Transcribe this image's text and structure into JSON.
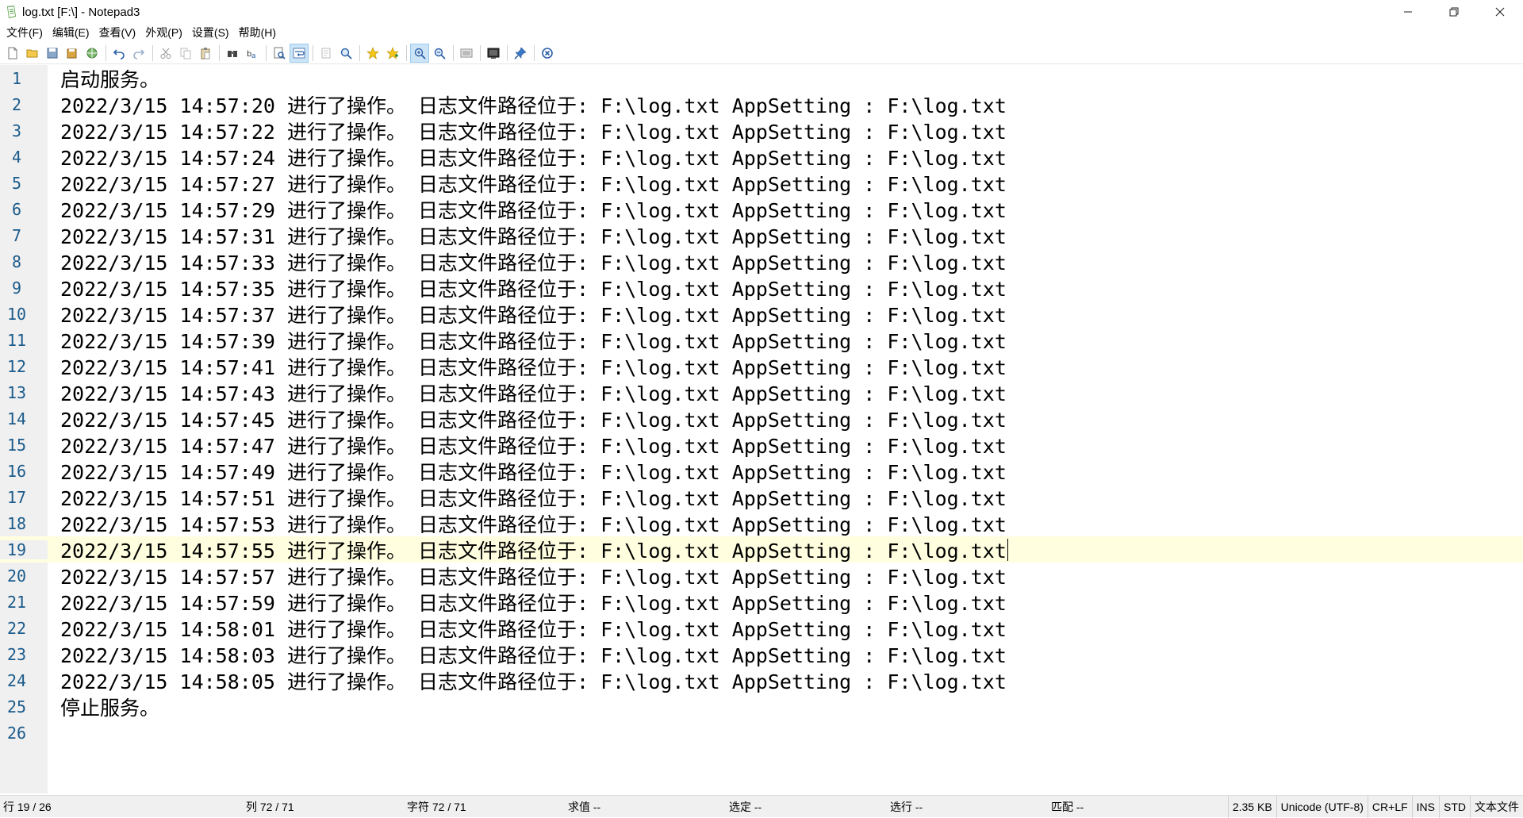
{
  "window": {
    "title": "log.txt [F:\\] - Notepad3",
    "controls": {
      "minimize": "—",
      "restore": "❐",
      "close": "✕"
    }
  },
  "menu": {
    "items": [
      "文件(F)",
      "编辑(E)",
      "查看(V)",
      "外观(P)",
      "设置(S)",
      "帮助(H)"
    ]
  },
  "toolbar": {
    "buttons": [
      "new-file-icon",
      "open-folder-icon",
      "save-icon",
      "save-as-icon",
      "browse-icon",
      "undo-icon",
      "redo-icon",
      "cut-icon",
      "copy-icon",
      "paste-icon",
      "find-icon",
      "replace-icon",
      "goto-icon",
      "word-wrap-icon",
      "zoom-in-icon",
      "zoom-out-icon",
      "favorites-icon",
      "add-favorite-icon",
      "search-icon",
      "filter-icon",
      "scheme-icon",
      "view-icon",
      "pin-icon",
      "exit-icon"
    ]
  },
  "editor": {
    "current_line": 19,
    "lines": [
      "启动服务。",
      "2022/3/15 14:57:20 进行了操作。 日志文件路径位于: F:\\log.txt AppSetting : F:\\log.txt",
      "2022/3/15 14:57:22 进行了操作。 日志文件路径位于: F:\\log.txt AppSetting : F:\\log.txt",
      "2022/3/15 14:57:24 进行了操作。 日志文件路径位于: F:\\log.txt AppSetting : F:\\log.txt",
      "2022/3/15 14:57:27 进行了操作。 日志文件路径位于: F:\\log.txt AppSetting : F:\\log.txt",
      "2022/3/15 14:57:29 进行了操作。 日志文件路径位于: F:\\log.txt AppSetting : F:\\log.txt",
      "2022/3/15 14:57:31 进行了操作。 日志文件路径位于: F:\\log.txt AppSetting : F:\\log.txt",
      "2022/3/15 14:57:33 进行了操作。 日志文件路径位于: F:\\log.txt AppSetting : F:\\log.txt",
      "2022/3/15 14:57:35 进行了操作。 日志文件路径位于: F:\\log.txt AppSetting : F:\\log.txt",
      "2022/3/15 14:57:37 进行了操作。 日志文件路径位于: F:\\log.txt AppSetting : F:\\log.txt",
      "2022/3/15 14:57:39 进行了操作。 日志文件路径位于: F:\\log.txt AppSetting : F:\\log.txt",
      "2022/3/15 14:57:41 进行了操作。 日志文件路径位于: F:\\log.txt AppSetting : F:\\log.txt",
      "2022/3/15 14:57:43 进行了操作。 日志文件路径位于: F:\\log.txt AppSetting : F:\\log.txt",
      "2022/3/15 14:57:45 进行了操作。 日志文件路径位于: F:\\log.txt AppSetting : F:\\log.txt",
      "2022/3/15 14:57:47 进行了操作。 日志文件路径位于: F:\\log.txt AppSetting : F:\\log.txt",
      "2022/3/15 14:57:49 进行了操作。 日志文件路径位于: F:\\log.txt AppSetting : F:\\log.txt",
      "2022/3/15 14:57:51 进行了操作。 日志文件路径位于: F:\\log.txt AppSetting : F:\\log.txt",
      "2022/3/15 14:57:53 进行了操作。 日志文件路径位于: F:\\log.txt AppSetting : F:\\log.txt",
      "2022/3/15 14:57:55 进行了操作。 日志文件路径位于: F:\\log.txt AppSetting : F:\\log.txt",
      "2022/3/15 14:57:57 进行了操作。 日志文件路径位于: F:\\log.txt AppSetting : F:\\log.txt",
      "2022/3/15 14:57:59 进行了操作。 日志文件路径位于: F:\\log.txt AppSetting : F:\\log.txt",
      "2022/3/15 14:58:01 进行了操作。 日志文件路径位于: F:\\log.txt AppSetting : F:\\log.txt",
      "2022/3/15 14:58:03 进行了操作。 日志文件路径位于: F:\\log.txt AppSetting : F:\\log.txt",
      "2022/3/15 14:58:05 进行了操作。 日志文件路径位于: F:\\log.txt AppSetting : F:\\log.txt",
      "停止服务。",
      ""
    ]
  },
  "status": {
    "line": "行 19 / 26",
    "column": "列 72 / 71",
    "char": "字符 72 / 71",
    "value": "求值 --",
    "selection": "选定 --",
    "selected_lines": "选行 --",
    "match": "匹配 --",
    "size": "2.35 KB",
    "encoding": "Unicode (UTF-8)",
    "eol": "CR+LF",
    "ins": "INS",
    "std": "STD",
    "filetype": "文本文件"
  }
}
